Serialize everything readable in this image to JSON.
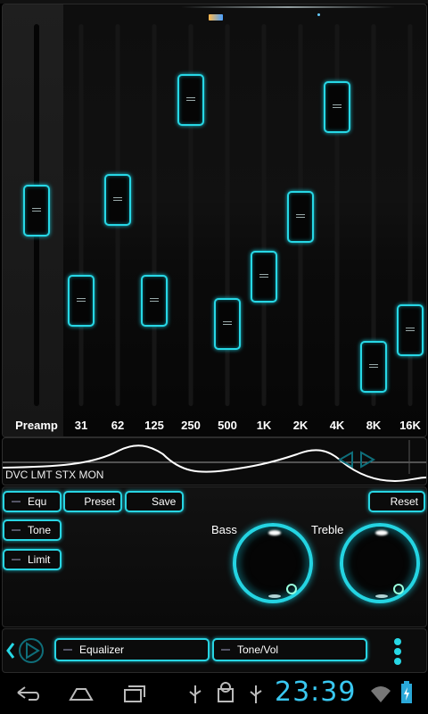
{
  "equalizer": {
    "preamp_label": "Preamp",
    "bands": [
      {
        "label": "31",
        "level": 0.25
      },
      {
        "label": "62",
        "level": 0.55
      },
      {
        "label": "125",
        "level": 0.25
      },
      {
        "label": "250",
        "level": 0.85
      },
      {
        "label": "500",
        "level": 0.18
      },
      {
        "label": "1K",
        "level": 0.32
      },
      {
        "label": "2K",
        "level": 0.5
      },
      {
        "label": "4K",
        "level": 0.83
      },
      {
        "label": "8K",
        "level": 0.05
      },
      {
        "label": "16K",
        "level": 0.16
      }
    ],
    "preamp_level": 0.52
  },
  "visualizer": {
    "tags": "DVC LMT STX MON"
  },
  "controls": {
    "equ_label": "Equ",
    "preset_label": "Preset",
    "save_label": "Save",
    "reset_label": "Reset",
    "tone_label": "Tone",
    "limit_label": "Limit",
    "bass_label": "Bass",
    "treble_label": "Treble"
  },
  "bottom": {
    "tab_equalizer": "Equalizer",
    "tab_tone": "Tone/Vol"
  },
  "status": {
    "time": "23:39"
  },
  "colors": {
    "accent": "#27d8e6",
    "clock": "#39c7f0"
  }
}
